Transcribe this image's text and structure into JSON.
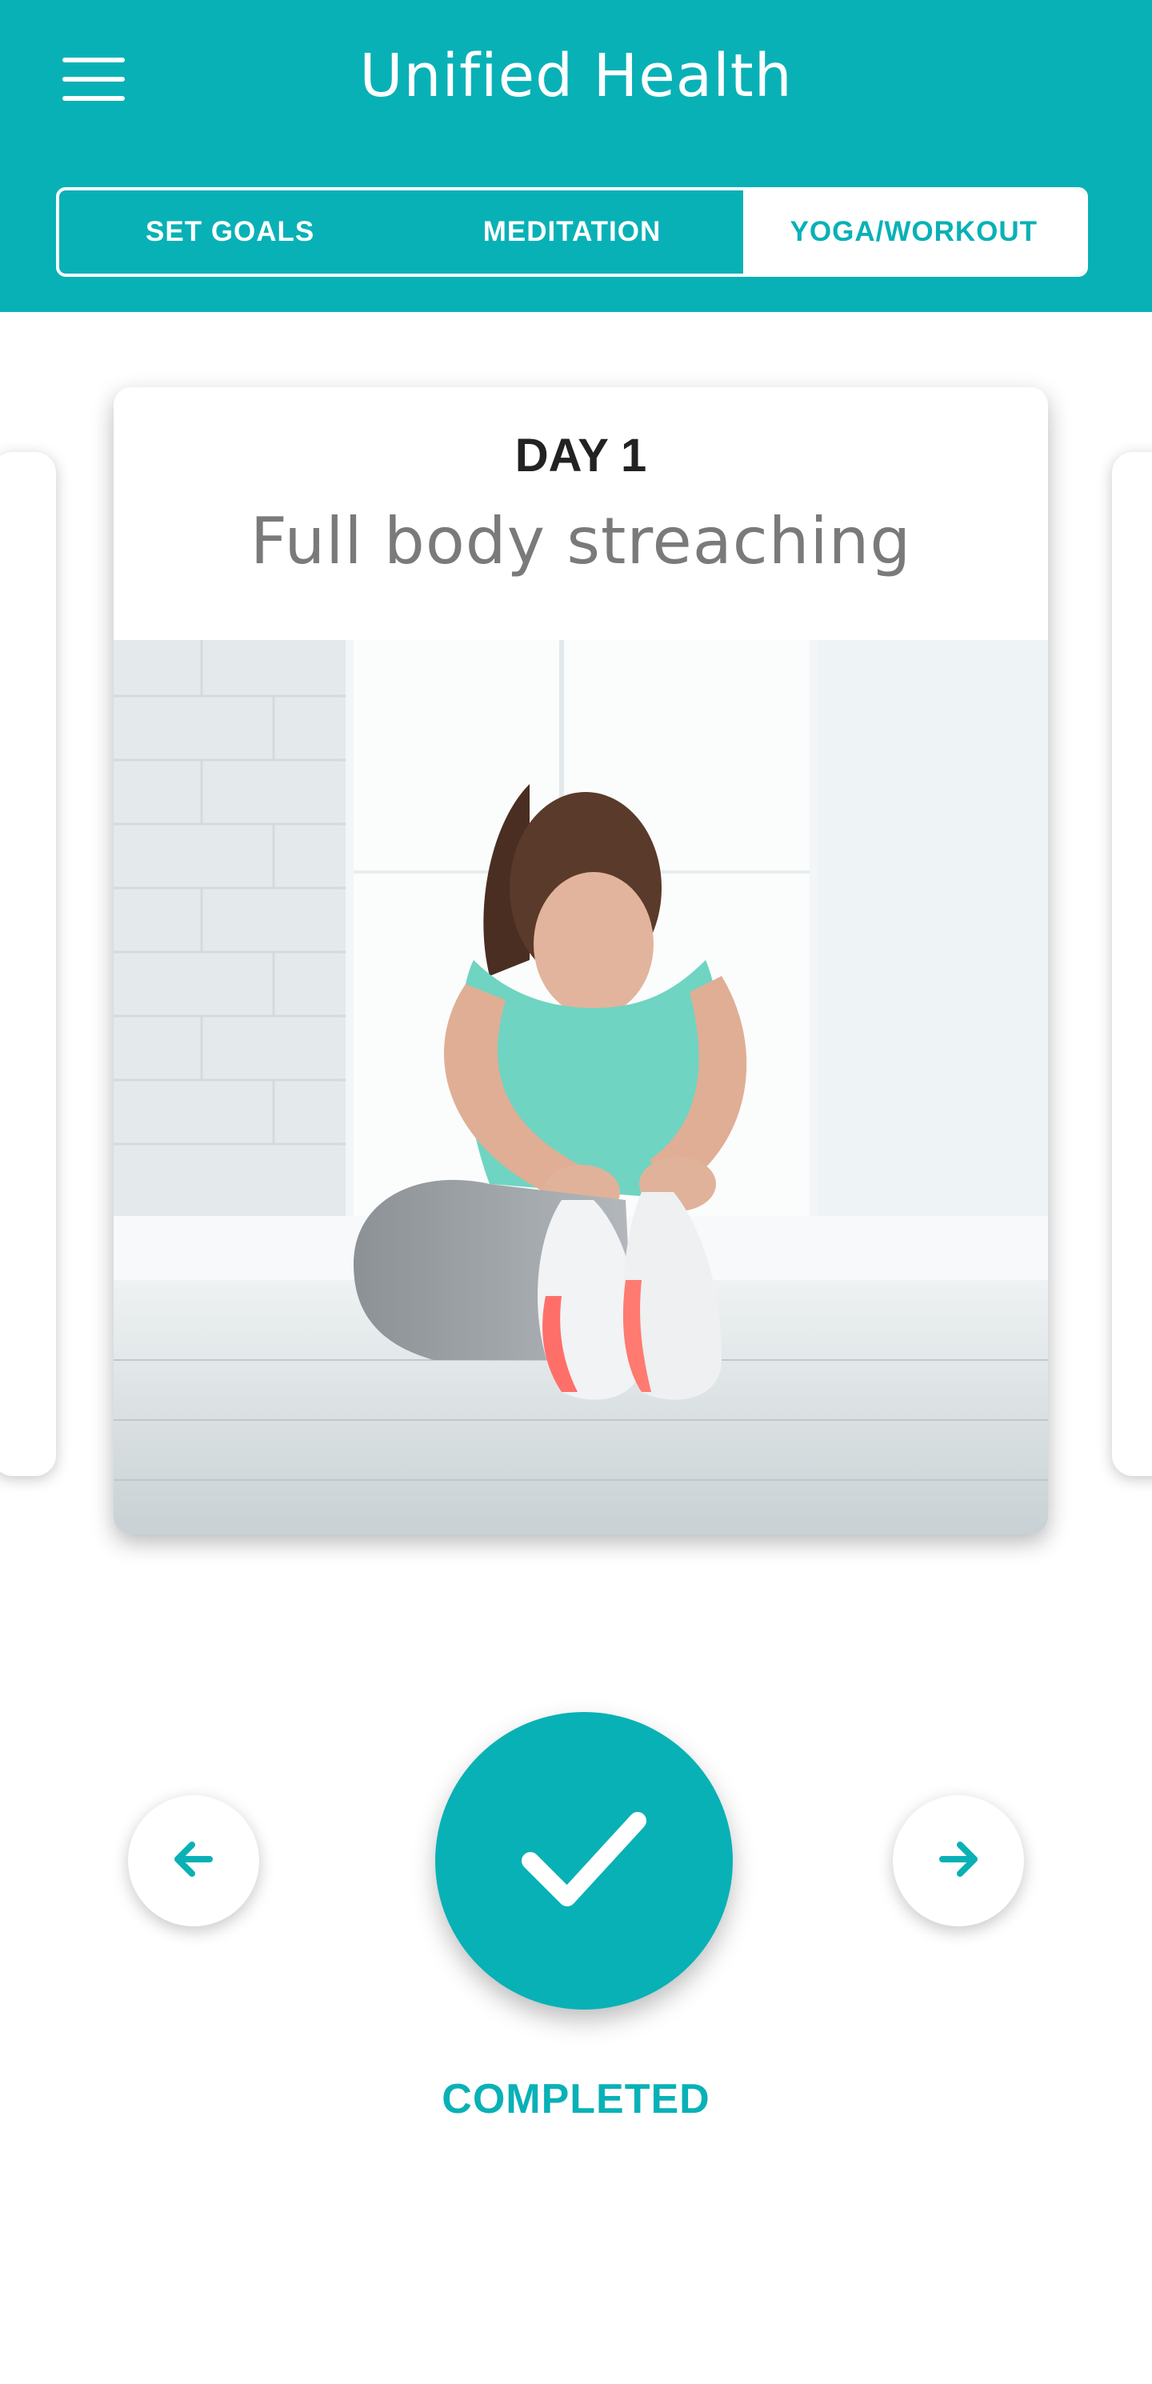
{
  "app": {
    "title": "Unified Health"
  },
  "colors": {
    "brand": "#08b1b6",
    "text_dark": "#222222",
    "text_muted": "#7a7a7a"
  },
  "tabs": [
    {
      "label": "SET GOALS",
      "active": false
    },
    {
      "label": "MEDITATION",
      "active": false
    },
    {
      "label": "YOGA/WORKOUT",
      "active": true
    }
  ],
  "workout": {
    "day_label": "DAY 1",
    "title": "Full body streaching"
  },
  "icons": {
    "menu": "hamburger-menu-icon",
    "prev": "arrow-left-icon",
    "next": "arrow-right-icon",
    "complete": "checkmark-icon"
  },
  "status": {
    "label": "COMPLETED"
  }
}
